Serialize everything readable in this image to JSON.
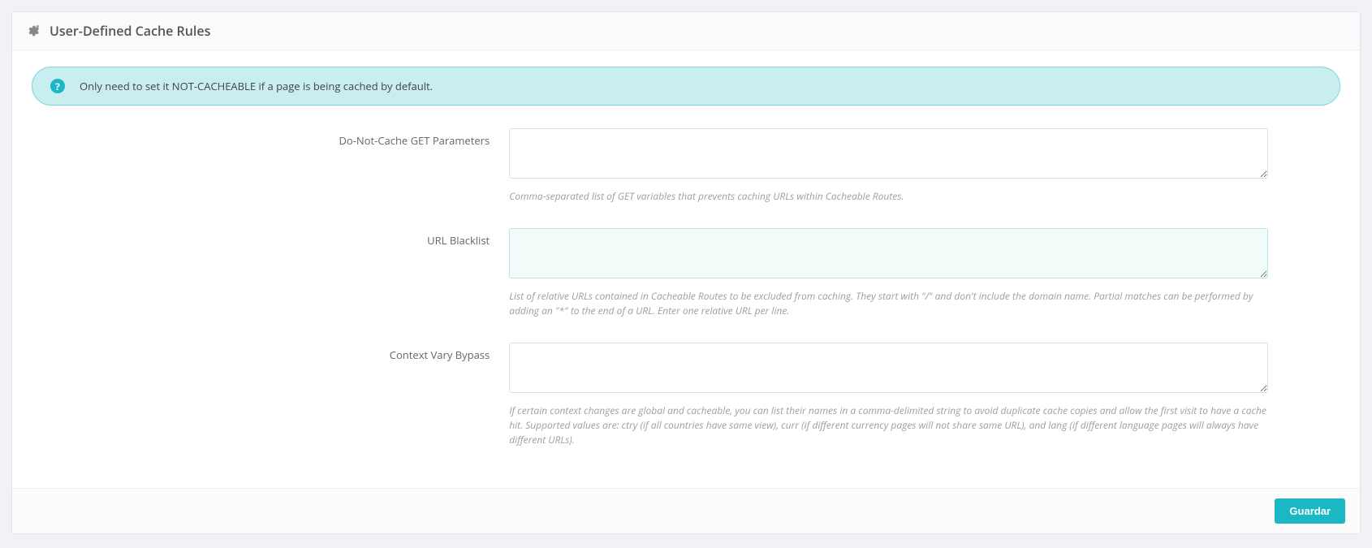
{
  "panel": {
    "title": "User-Defined Cache Rules",
    "banner_text": "Only need to set it NOT-CACHEABLE if a page is being cached by default."
  },
  "fields": {
    "dnc_params": {
      "label": "Do-Not-Cache GET Parameters",
      "value": "",
      "help": "Comma-separated list of GET variables that prevents caching URLs within Cacheable Routes."
    },
    "url_blacklist": {
      "label": "URL Blacklist",
      "value": "",
      "help": "List of relative URLs contained in Cacheable Routes to be excluded from caching. They start with \"/\" and don't include the domain name. Partial matches can be performed by adding an \"*\" to the end of a URL. Enter one relative URL per line."
    },
    "context_vary": {
      "label": "Context Vary Bypass",
      "value": "",
      "help": "If certain context changes are global and cacheable, you can list their names in a comma-delimited string to avoid duplicate cache copies and allow the first visit to have a cache hit. Supported values are: ctry (if all countries have same view), curr (if different currency pages will not share same URL), and lang (if different language pages will always have different URLs)."
    }
  },
  "buttons": {
    "save": "Guardar"
  }
}
